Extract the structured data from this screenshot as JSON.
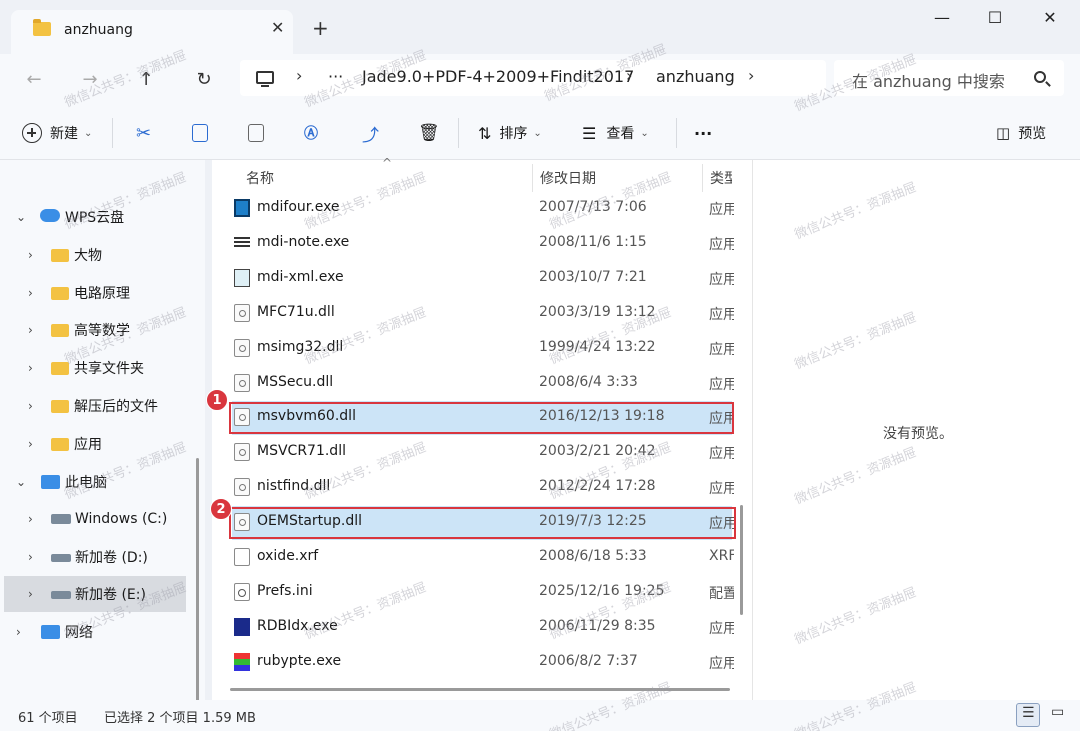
{
  "tab": {
    "title": "anzhuang"
  },
  "breadcrumb": {
    "ellipsis": "···",
    "path1": "Jade9.0+PDF-4+2009+Findit2017",
    "path2": "anzhuang"
  },
  "search": {
    "placeholder": "在 anzhuang 中搜索"
  },
  "toolbar": {
    "new_label": "新建",
    "sort_label": "排序",
    "view_label": "查看",
    "more_label": "···",
    "preview_label": "预览"
  },
  "sidebar": {
    "items": [
      {
        "label": "WPS云盘"
      },
      {
        "label": "大物"
      },
      {
        "label": "电路原理"
      },
      {
        "label": "高等数学"
      },
      {
        "label": "共享文件夹"
      },
      {
        "label": "解压后的文件"
      },
      {
        "label": "应用"
      },
      {
        "label": "此电脑"
      },
      {
        "label": "Windows (C:)"
      },
      {
        "label": "新加卷 (D:)"
      },
      {
        "label": "新加卷 (E:)"
      },
      {
        "label": "网络"
      }
    ]
  },
  "columns": {
    "name": "名称",
    "date": "修改日期",
    "type": "类型"
  },
  "files": [
    {
      "name": "mdifour.exe",
      "date": "2007/7/13 7:06",
      "type": "应用"
    },
    {
      "name": "mdi-note.exe",
      "date": "2008/11/6 1:15",
      "type": "应用"
    },
    {
      "name": "mdi-xml.exe",
      "date": "2003/10/7 7:21",
      "type": "应用"
    },
    {
      "name": "MFC71u.dll",
      "date": "2003/3/19 13:12",
      "type": "应用"
    },
    {
      "name": "msimg32.dll",
      "date": "1999/4/24 13:22",
      "type": "应用"
    },
    {
      "name": "MSSecu.dll",
      "date": "2008/6/4 3:33",
      "type": "应用"
    },
    {
      "name": "msvbvm60.dll",
      "date": "2016/12/13 19:18",
      "type": "应用"
    },
    {
      "name": "MSVCR71.dll",
      "date": "2003/2/21 20:42",
      "type": "应用"
    },
    {
      "name": "nistfind.dll",
      "date": "2012/2/24 17:28",
      "type": "应用"
    },
    {
      "name": "OEMStartup.dll",
      "date": "2019/7/3 12:25",
      "type": "应用"
    },
    {
      "name": "oxide.xrf",
      "date": "2008/6/18 5:33",
      "type": "XRF"
    },
    {
      "name": "Prefs.ini",
      "date": "2025/12/16 19:25",
      "type": "配置"
    },
    {
      "name": "RDBIdx.exe",
      "date": "2006/11/29 8:35",
      "type": "应用"
    },
    {
      "name": "rubypte.exe",
      "date": "2006/8/2 7:37",
      "type": "应用"
    }
  ],
  "badges": {
    "one": "1",
    "two": "2"
  },
  "preview": {
    "empty_text": "没有预览。"
  },
  "status": {
    "count": "61 个项目",
    "selected": "已选择 2 个项目  1.59 MB"
  },
  "watermark": {
    "text": "微信公共号：资源抽屉"
  },
  "colors": {
    "selection": "#cce4f7",
    "highlight": "#d9363e",
    "folder": "#f3c242"
  }
}
